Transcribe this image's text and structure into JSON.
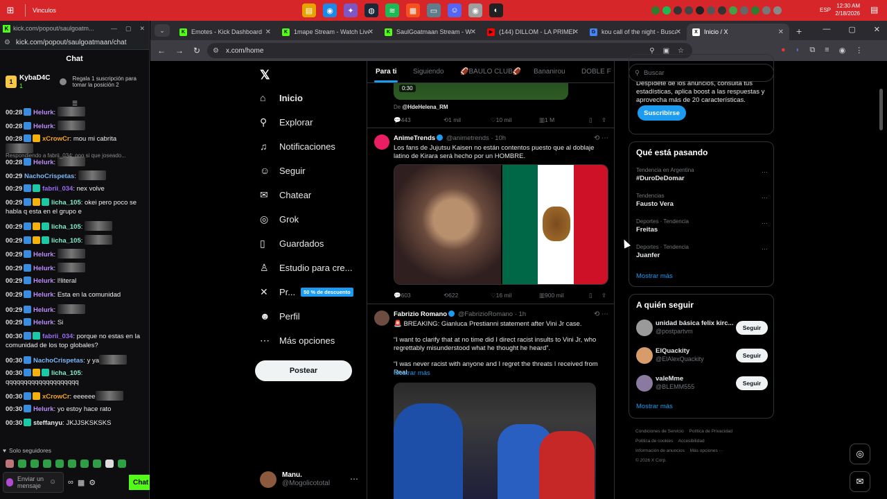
{
  "taskbar": {
    "title": "Vinculos",
    "lang": "ESP",
    "time": "12:30 AM",
    "date": "2/18/2026"
  },
  "popup": {
    "tab_title": "kick.com/popout/saulgoatm...",
    "url": "kick.com/popout/saulgoatmaan/chat",
    "chat_title": "Chat",
    "gifter": {
      "name": "KybaD4C",
      "count": "1"
    },
    "gift_text": "Regala 1 suscripción para tomar la posición 2",
    "reply_note": "Respondiendo a fabrii_034: ooo si que joseado...",
    "followers_only": "Solo seguidores",
    "input_placeholder": "Enviar un mensaje",
    "chat_button": "Chat"
  },
  "chat": [
    {
      "time": "00:28",
      "user": "Helurk",
      "color": "#b98cf7",
      "text": "",
      "badges": [
        "bb"
      ],
      "emote": true
    },
    {
      "time": "00:28",
      "user": "Helurk",
      "color": "#b98cf7",
      "text": "",
      "badges": [
        "bb"
      ],
      "emote": true
    },
    {
      "time": "00:28",
      "user": "xCrowCr",
      "color": "#f5a524",
      "text": "mou mi cabrita",
      "badges": [
        "bb",
        "bg"
      ],
      "emote": true
    },
    {
      "time": "00:28",
      "user": "Helurk",
      "color": "#b98cf7",
      "text": "",
      "badges": [
        "bb"
      ],
      "emote": true
    },
    {
      "time": "00:29",
      "user": "NachoCrispetas",
      "color": "#7ab7f7",
      "text": "",
      "badges": [],
      "emote": true
    },
    {
      "time": "00:29",
      "user": "fabrii_034",
      "color": "#9c6cf6",
      "text": "nex volve",
      "badges": [
        "bb",
        "bt"
      ],
      "emote": false
    },
    {
      "time": "00:29",
      "user": "licha_105",
      "color": "#7ef0c8",
      "text": "okei pero poco se habla q esta en el grupo e",
      "badges": [
        "bb",
        "bg",
        "bt"
      ],
      "emote": false
    },
    {
      "time": "00:29",
      "user": "licha_105",
      "color": "#7ef0c8",
      "text": "",
      "badges": [
        "bb",
        "bg",
        "bt"
      ],
      "emote": true
    },
    {
      "time": "00:29",
      "user": "licha_105",
      "color": "#7ef0c8",
      "text": "",
      "badges": [
        "bb",
        "bg",
        "bt"
      ],
      "emote": true
    },
    {
      "time": "00:29",
      "user": "Helurk",
      "color": "#b98cf7",
      "text": "",
      "badges": [
        "bb"
      ],
      "emote": true
    },
    {
      "time": "00:29",
      "user": "Helurk",
      "color": "#b98cf7",
      "text": "",
      "badges": [
        "bb"
      ],
      "emote": true
    },
    {
      "time": "00:29",
      "user": "Helurk",
      "color": "#b98cf7",
      "text": "l!literal",
      "badges": [
        "bb"
      ],
      "emote": false
    },
    {
      "time": "00:29",
      "user": "Helurk",
      "color": "#b98cf7",
      "text": "Esta en la comunidad",
      "badges": [
        "bb"
      ],
      "emote": false
    },
    {
      "time": "00:29",
      "user": "Helurk",
      "color": "#b98cf7",
      "text": "",
      "badges": [
        "bb"
      ],
      "emote": true
    },
    {
      "time": "00:29",
      "user": "Helurk",
      "color": "#b98cf7",
      "text": "Si",
      "badges": [
        "bb"
      ],
      "emote": false
    },
    {
      "time": "00:30",
      "user": "fabrii_034",
      "color": "#9c6cf6",
      "text": "porque no estas en la comunidad de los top globales?",
      "badges": [
        "bb",
        "bt"
      ],
      "emote": false
    },
    {
      "time": "00:30",
      "user": "NachoCrispetas",
      "color": "#7ab7f7",
      "text": "y ya",
      "badges": [
        "bb"
      ],
      "emote": true
    },
    {
      "time": "00:30",
      "user": "licha_105",
      "color": "#7ef0c8",
      "text": "qqqqqqqqqqqqqqqqqqqq",
      "badges": [
        "bb",
        "bg",
        "bt"
      ],
      "emote": false
    },
    {
      "time": "00:30",
      "user": "xCrowCr",
      "color": "#f5a524",
      "text": "eeeeee",
      "badges": [
        "bb",
        "bg"
      ],
      "emote": true
    },
    {
      "time": "00:30",
      "user": "Helurk",
      "color": "#b98cf7",
      "text": "yo estoy hace rato",
      "badges": [
        "bb"
      ],
      "emote": false
    },
    {
      "time": "00:30",
      "user": "steffanyu",
      "color": "#e7e9ea",
      "text": "JKJJSKSKSKS",
      "badges": [
        "bt"
      ],
      "emote": false
    }
  ],
  "browser": {
    "tabs": [
      {
        "label": "Emotes - Kick Dashboard",
        "fav": "K",
        "color": "#53fc18"
      },
      {
        "label": "1mape Stream - Watch Live",
        "fav": "K",
        "color": "#53fc18"
      },
      {
        "label": "SaulGoatmaan Stream - Wat",
        "fav": "K",
        "color": "#53fc18"
      },
      {
        "label": "(144) DILLOM - LA PRIMERA",
        "fav": "▶",
        "color": "#ff0000"
      },
      {
        "label": "kou call of the night - Busca",
        "fav": "G",
        "color": "#4285f4"
      },
      {
        "label": "Inicio / X",
        "fav": "X",
        "color": "#ffffff"
      }
    ],
    "url": "x.com/home"
  },
  "x": {
    "nav": [
      {
        "label": "Inicio",
        "icon": "home-icon",
        "glyph": "⌂"
      },
      {
        "label": "Explorar",
        "icon": "search-icon",
        "glyph": "⚲"
      },
      {
        "label": "Notificaciones",
        "icon": "bell-icon",
        "glyph": "♫"
      },
      {
        "label": "Seguir",
        "icon": "follow-icon",
        "glyph": "☺"
      },
      {
        "label": "Chatear",
        "icon": "mail-icon",
        "glyph": "✉"
      },
      {
        "label": "Grok",
        "icon": "grok-icon",
        "glyph": "◎"
      },
      {
        "label": "Guardados",
        "icon": "bookmark-icon",
        "glyph": "▯"
      },
      {
        "label": "Estudio para cre...",
        "icon": "studio-icon",
        "glyph": "♙"
      },
      {
        "label": "Pr...",
        "icon": "x-premium-icon",
        "glyph": "✕"
      },
      {
        "label": "Perfil",
        "icon": "profile-icon",
        "glyph": "☻"
      },
      {
        "label": "Más opciones",
        "icon": "more-icon",
        "glyph": "⋯"
      }
    ],
    "premium_badge": "50 % de descuento",
    "post_button": "Postear",
    "me": {
      "name": "Manu.",
      "handle": "@Mogolicototal"
    },
    "feed_tabs": [
      "Para ti",
      "Siguiendo",
      "🏈BAULO CLUB🏈",
      "Bananirou",
      "DOBLE F"
    ],
    "prev": {
      "duration": "0:30",
      "byline_prefix": "De",
      "byline_handle": "@HdeHelena_RM",
      "replies": "443",
      "retweets": "1 mil",
      "likes": "10 mil",
      "views": "1 M"
    },
    "t1": {
      "name": "AnimeTrends",
      "handle": "@animetrends",
      "time": "10h",
      "text": "Los fans de Jujutsu Kaisen no están contentos puesto que al doblaje latino de Kirara será hecho por un HOMBRE.",
      "replies": "603",
      "retweets": "622",
      "likes": "16 mil",
      "views": "900 mil"
    },
    "t2": {
      "name": "Fabrizio Romano",
      "handle": "@FabrizioRomano",
      "time": "1h",
      "line1": "🚨 BREAKING: Gianluca Prestianni statement after Vini Jr case.",
      "line2": "“I want to clarify that at no time did I direct racist insults to Vini Jr, who regrettably misunderstood what he thought he heard”.",
      "line3": "“I was never racist with anyone and I regret the threats I received from Real",
      "more": "Mostrar más"
    },
    "search_placeholder": "Buscar",
    "premium_text": "Despídete de los anuncios, consulta tus estadísticas, aplica boost a las respuestas y aprovecha más de 20 características.",
    "subscribe": "Suscribirse",
    "trends_title": "Qué está pasando",
    "trends": [
      {
        "cat": "Tendencia en Argentina",
        "name": "#DuroDeDomar"
      },
      {
        "cat": "Tendencias",
        "name": "Fausto Vera"
      },
      {
        "cat": "Deportes · Tendencia",
        "name": "Freitas"
      },
      {
        "cat": "Deportes · Tendencia",
        "name": "Juanfer"
      }
    ],
    "show_more": "Mostrar más",
    "follow_title": "A quién seguir",
    "follow": [
      {
        "name": "unidad básica felix kirc...",
        "handle": "@postpartvm",
        "color": "#9a9a9a"
      },
      {
        "name": "ElQuackity",
        "handle": "@ElAlexQuackity",
        "color": "#d89b6a"
      },
      {
        "name": "valeMme",
        "handle": "@BLEMM555",
        "color": "#8a7aa0"
      }
    ],
    "follow_btn": "Seguir",
    "footer": [
      "Condiciones de Servicio",
      "Política de Privacidad",
      "Política de cookies",
      "Accesibilidad",
      "Información de anuncios",
      "Más opciones ···",
      "© 2026 X Corp."
    ]
  }
}
